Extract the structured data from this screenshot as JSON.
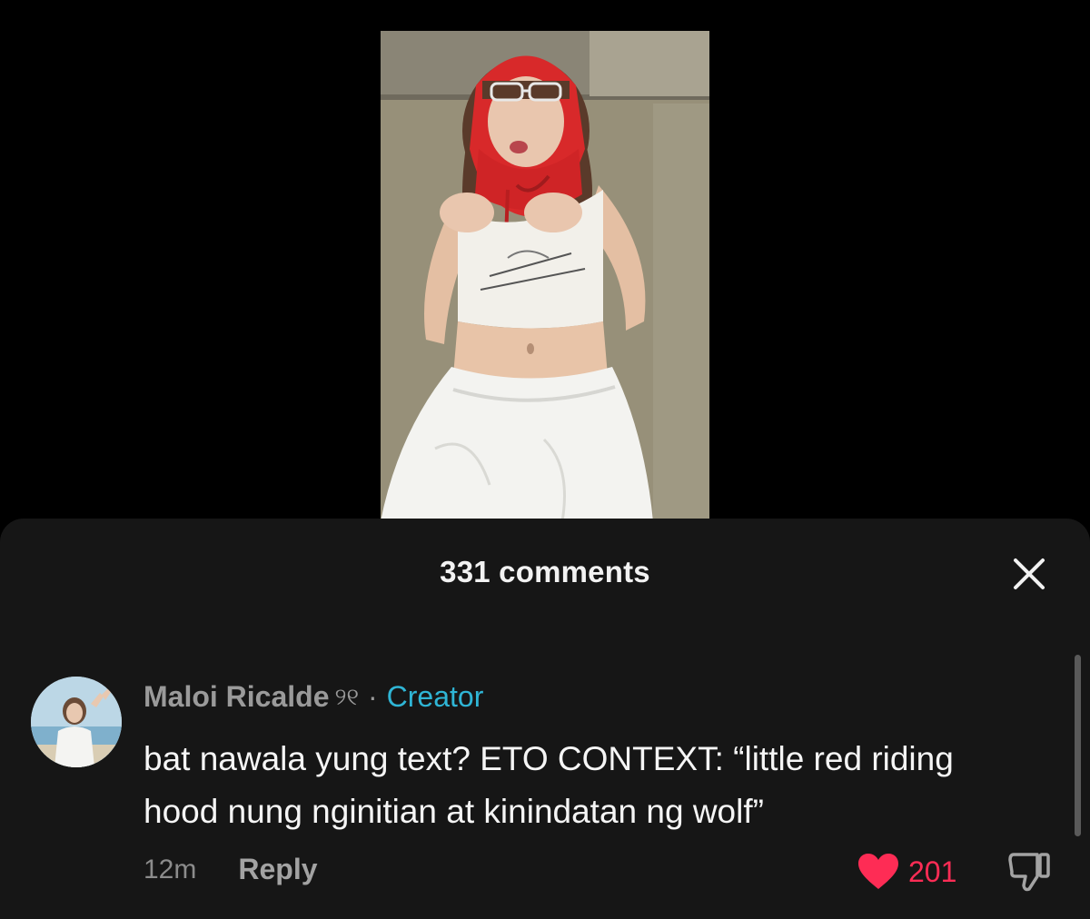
{
  "video": {
    "icon": "video-thumbnail"
  },
  "comments_sheet": {
    "title": "331 comments",
    "close_icon": "close-icon"
  },
  "comment": {
    "username": "Maloi Ricalde",
    "name_suffix": "୨୧",
    "separator": "·",
    "badge": "Creator",
    "text": "bat nawala yung text? ETO CONTEXT: “little red riding hood nung nginitian at kinindatan ng wolf”",
    "time": "12m",
    "reply_label": "Reply",
    "like_count": "201",
    "liked": true,
    "like_icon": "heart-icon",
    "dislike_icon": "thumbs-down-icon"
  },
  "colors": {
    "background": "#000000",
    "sheet": "#161616",
    "creator_accent": "#2fb5d5",
    "like_accent": "#fe2c55"
  }
}
